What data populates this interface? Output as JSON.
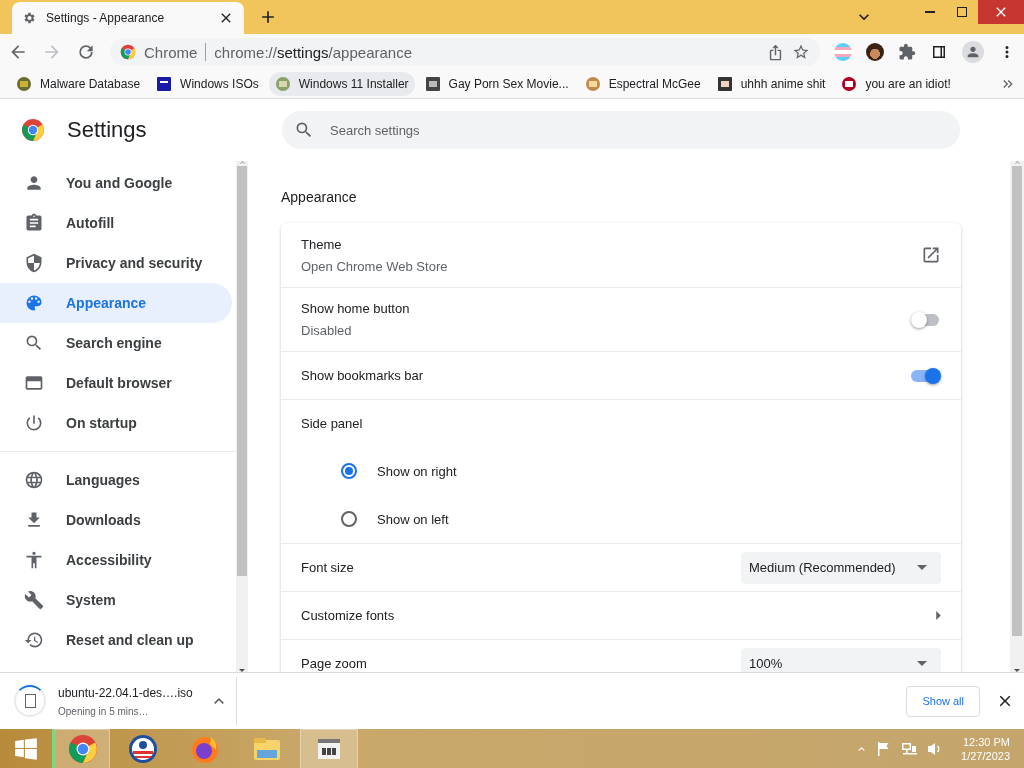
{
  "tab": {
    "title": "Settings - Appearance"
  },
  "toolbar": {
    "site_label": "Chrome",
    "url_host": "chrome://",
    "url_path": "settings",
    "url_rest": "/appearance"
  },
  "bookmarks": [
    {
      "label": "Malware Database",
      "selected": false
    },
    {
      "label": "Windows ISOs",
      "selected": false
    },
    {
      "label": "Windows 11 Installer",
      "selected": true
    },
    {
      "label": "Gay Porn Sex Movie...",
      "selected": false
    },
    {
      "label": "Espectral McGee",
      "selected": false
    },
    {
      "label": "uhhh anime shit",
      "selected": false
    },
    {
      "label": "you are an idiot!",
      "selected": false
    }
  ],
  "settings": {
    "title": "Settings",
    "search": {
      "placeholder": "Search settings"
    },
    "sidebar": {
      "groups": [
        {
          "items": [
            {
              "label": "You and Google",
              "selected": false
            },
            {
              "label": "Autofill",
              "selected": false
            },
            {
              "label": "Privacy and security",
              "selected": false
            },
            {
              "label": "Appearance",
              "selected": true
            },
            {
              "label": "Search engine",
              "selected": false
            },
            {
              "label": "Default browser",
              "selected": false
            },
            {
              "label": "On startup",
              "selected": false
            }
          ]
        },
        {
          "items": [
            {
              "label": "Languages",
              "selected": false
            },
            {
              "label": "Downloads",
              "selected": false
            },
            {
              "label": "Accessibility",
              "selected": false
            },
            {
              "label": "System",
              "selected": false
            },
            {
              "label": "Reset and clean up",
              "selected": false
            }
          ]
        }
      ]
    },
    "section": {
      "title": "Appearance",
      "rows": [
        {
          "kind": "link",
          "label": "Theme",
          "sublabel": "Open Chrome Web Store"
        },
        {
          "kind": "toggle",
          "label": "Show home button",
          "sublabel": "Disabled",
          "on": false
        },
        {
          "kind": "toggle",
          "label": "Show bookmarks bar",
          "on": true
        },
        {
          "kind": "heading",
          "label": "Side panel"
        },
        {
          "kind": "radio",
          "label": "Show on right",
          "selected": true
        },
        {
          "kind": "radio",
          "label": "Show on left",
          "selected": false
        },
        {
          "kind": "select",
          "label": "Font size",
          "value": "Medium (Recommended)"
        },
        {
          "kind": "submenu",
          "label": "Customize fonts"
        },
        {
          "kind": "select",
          "label": "Page zoom",
          "value": "100%"
        }
      ]
    }
  },
  "downloads": {
    "filename": "ubuntu-22.04.1-des….iso",
    "status": "Opening in 5 mins…",
    "show_all": "Show all"
  },
  "taskbar": {
    "apps": [
      {
        "selected": true,
        "open": true
      },
      {
        "selected": false,
        "open": false
      },
      {
        "selected": false,
        "open": false
      },
      {
        "selected": false,
        "open": false
      },
      {
        "selected": false,
        "open": true
      }
    ],
    "time": "12:30 PM",
    "date": "1/27/2023"
  }
}
